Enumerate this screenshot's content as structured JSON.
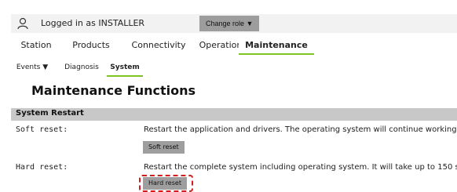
{
  "header": {
    "user_icon": "user-icon",
    "logged_in_text": "Logged in as INSTALLER",
    "change_role_label": "Change role ▼"
  },
  "main_nav": {
    "tabs": [
      {
        "label": "Station"
      },
      {
        "label": "Products"
      },
      {
        "label": "Connectivity"
      },
      {
        "label": "Operation"
      },
      {
        "label": "Maintenance",
        "active": true
      }
    ]
  },
  "sub_nav": {
    "tabs": [
      {
        "label": "Events ▼"
      },
      {
        "label": "Diagnosis"
      },
      {
        "label": "System",
        "active": true
      }
    ]
  },
  "page": {
    "title": "Maintenance Functions"
  },
  "section": {
    "title": "System Restart",
    "rows": [
      {
        "label": "Soft reset:",
        "description": "Restart the application and drivers. The operating system will continue working.",
        "button_label": "Soft reset"
      },
      {
        "label": "Hard reset:",
        "description": "Restart the complete system including operating system. It will take up to 150 s",
        "button_label": "Hard reset"
      }
    ]
  },
  "colors": {
    "accent": "#7ec61f",
    "section_header": "#c8c8c8",
    "button": "#9e9e9e",
    "highlight": "#d01c1c"
  }
}
